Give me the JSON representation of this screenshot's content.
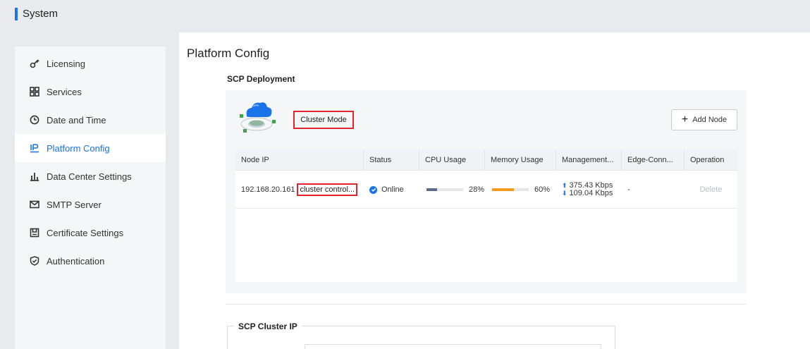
{
  "header": {
    "title": "System"
  },
  "sidebar": {
    "items": [
      {
        "label": "Licensing",
        "icon": "key-icon",
        "active": false
      },
      {
        "label": "Services",
        "icon": "grid-icon",
        "active": false
      },
      {
        "label": "Date and Time",
        "icon": "clock-icon",
        "active": false
      },
      {
        "label": "Platform Config",
        "icon": "ip-icon",
        "active": true
      },
      {
        "label": "Data Center Settings",
        "icon": "bar-chart-icon",
        "active": false
      },
      {
        "label": "SMTP Server",
        "icon": "mail-icon",
        "active": false
      },
      {
        "label": "Certificate Settings",
        "icon": "certificate-icon",
        "active": false
      },
      {
        "label": "Authentication",
        "icon": "shield-icon",
        "active": false
      }
    ]
  },
  "main": {
    "title": "Platform Config",
    "deployment": {
      "title": "SCP Deployment",
      "mode": "Cluster Mode",
      "add_node_label": "Add Node",
      "table": {
        "columns": [
          "Node IP",
          "Status",
          "CPU Usage",
          "Memory Usage",
          "Management...",
          "Edge-Conn...",
          "Operation"
        ],
        "rows": [
          {
            "node_ip": "192.168.20.161",
            "role": "cluster control...",
            "status": "Online",
            "cpu_usage": "28%",
            "cpu_fraction": 0.28,
            "memory_usage": "60%",
            "memory_fraction": 0.6,
            "management_up": "375.43 Kbps",
            "management_down": "109.04 Kbps",
            "edge_conn": "-",
            "operation": "Delete"
          }
        ]
      }
    },
    "cluster_ip": {
      "title": "SCP Cluster IP"
    }
  },
  "colors": {
    "accent": "#1a73e8",
    "highlight": "#e0262b",
    "cpu_bar": "#5b6b8c",
    "memory_bar": "#f59a23",
    "online": "#1a73e8"
  }
}
